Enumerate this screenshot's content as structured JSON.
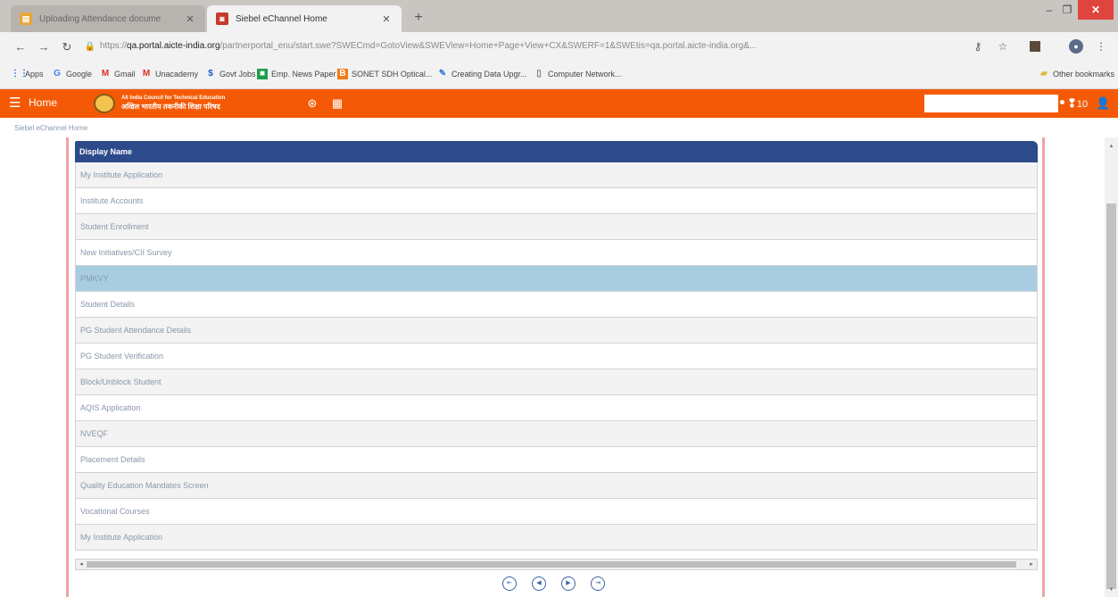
{
  "browser": {
    "tabs": [
      {
        "title": "Uploading Attendance docume",
        "favicon": "document-icon",
        "active": false
      },
      {
        "title": "Siebel eChannel Home",
        "favicon": "siebel-icon",
        "active": true
      }
    ],
    "url": {
      "scheme": "https://",
      "host": "qa.portal.aicte-india.org",
      "path": "/partnerportal_enu/start.swe?SWECmd=GotoView&SWEView=Home+Page+View+CX&SWERF=1&SWEtis=qa.portal.aicte-india.org&..."
    },
    "bookmarks": [
      {
        "label": "Apps",
        "icon": "apps-icon"
      },
      {
        "label": "Google",
        "icon": "google-icon"
      },
      {
        "label": "Gmail",
        "icon": "gmail-icon"
      },
      {
        "label": "Unacademy",
        "icon": "gmail-icon"
      },
      {
        "label": "Govt Jobs",
        "icon": "dollar-icon"
      },
      {
        "label": "Emp. News Paper",
        "icon": "green-square-icon"
      },
      {
        "label": "SONET SDH Optical...",
        "icon": "orange-square-icon"
      },
      {
        "label": "Creating Data Upgr...",
        "icon": "data-icon"
      },
      {
        "label": "Computer Network...",
        "icon": "page-icon"
      }
    ],
    "other_bookmarks": "Other bookmarks",
    "colors": {
      "close": "#e0443e",
      "titlebar": "#c9c6c2"
    }
  },
  "app": {
    "home_label": "Home",
    "org_line1": "All India Council for Technical Education",
    "org_line2": "अखिल भारतीय तकनीकी शिक्षा परिषद",
    "notification_count": "10",
    "accent": "#f45a05"
  },
  "breadcrumb": "Siebel eChannel Home",
  "grid": {
    "header": "Display Name",
    "rows": [
      "My Institute Application",
      "Institute Accounts",
      "Student Enrollment",
      "New Initiatives/CII Survey",
      "PMKVY",
      "Student Details",
      "PG Student Attendance Details",
      "PG Student Verification",
      "Block/Unblock Student",
      "AQIS Application",
      "NVEQF",
      "Placement Details",
      "Quality Education Mandates Screen",
      "Vocational Courses",
      "My Institute Application"
    ],
    "selected_index": 4,
    "header_color": "#2d4b8a",
    "selected_color": "#a9cde0"
  }
}
